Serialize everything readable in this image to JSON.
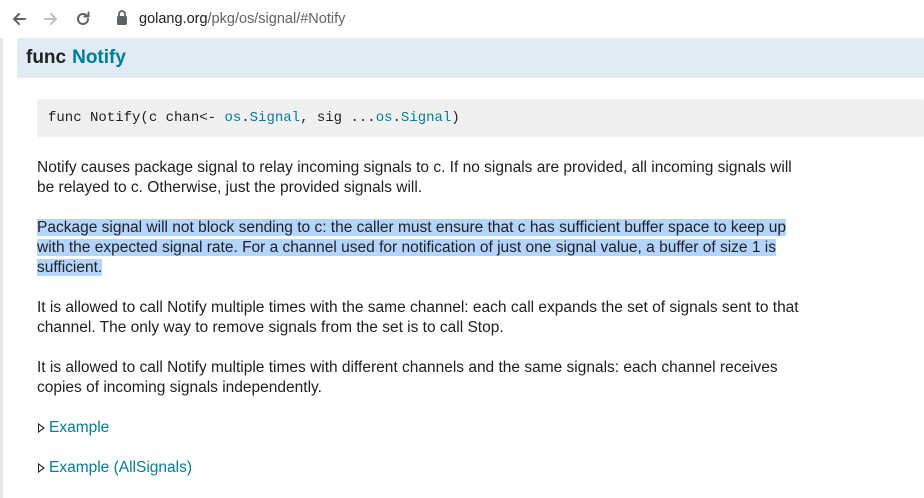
{
  "browser": {
    "url_host": "golang.org",
    "url_path": "/pkg/os/signal/#Notify",
    "back_icon": "arrow-left-icon",
    "forward_icon": "arrow-right-icon",
    "reload_icon": "reload-icon",
    "lock_icon": "lock-icon"
  },
  "func": {
    "keyword": "func",
    "name": "Notify"
  },
  "signature": {
    "part1": "func Notify(c chan<- ",
    "type1_pkg": "os",
    "dot1": ".",
    "type1_name": "Signal",
    "part2": ", sig ...",
    "type2_pkg": "os",
    "dot2": ".",
    "type2_name": "Signal",
    "part3": ")"
  },
  "paragraphs": {
    "p1_line1": "Notify causes package signal to relay incoming signals to c. If no signals are provided, all incoming signals will",
    "p1_line2": "be relayed to c. Otherwise, just the provided signals will.",
    "p2_line1": "Package signal will not block sending to c: the caller must ensure that c has sufficient buffer space to keep up",
    "p2_line2": "with the expected signal rate. For a channel used for notification of just one signal value, a buffer of size 1 is",
    "p2_line3": "sufficient.",
    "p3_line1": "It is allowed to call Notify multiple times with the same channel: each call expands the set of signals sent to that",
    "p3_line2": "channel. The only way to remove signals from the set is to call Stop.",
    "p4_line1": "It is allowed to call Notify multiple times with different channels and the same signals: each channel receives",
    "p4_line2": "copies of incoming signals independently."
  },
  "examples": [
    {
      "label": "Example"
    },
    {
      "label": "Example (AllSignals)"
    }
  ],
  "colors": {
    "link": "#007d9c",
    "header_bg": "#e0ebf5",
    "code_bg": "#f0f0f0",
    "selection": "#b3d4fc"
  }
}
